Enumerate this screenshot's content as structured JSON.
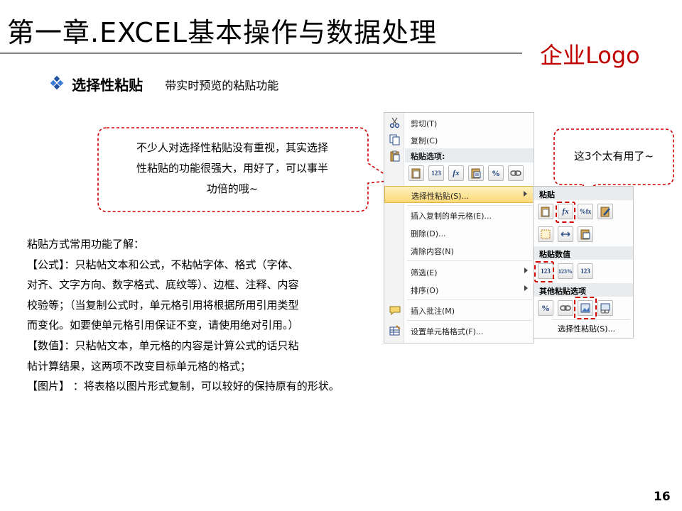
{
  "slide": {
    "title": "第一章.EXCEL基本操作与数据处理",
    "logo": "企业Logo",
    "page_number": "16"
  },
  "section": {
    "heading": "选择性粘贴",
    "description": "带实时预览的粘贴功能"
  },
  "callout_left": {
    "lines": [
      "不少人对选择性粘贴没有重视，其实选择",
      "性粘贴的功能很强大，用好了，可以事半",
      "功倍的哦~"
    ]
  },
  "callout_right": {
    "text": "这3个太有用了~"
  },
  "body": {
    "lines": [
      "粘贴方式常用功能了解：",
      "【公式】：只粘帖文本和公式，不粘帖字体、格式（字体、",
      "对齐、文字方向、数字格式、底纹等）、边框、注释、内容",
      "校验等；（当复制公式时，单元格引用将根据所用引用类型",
      "而变化。如要使单元格引用保证不变，请使用绝对引用。）",
      "【数值】：只粘帖文本，单元格的内容是计算公式的话只粘",
      "帖计算结果，这两项不改变目标单元格的格式；",
      "【图片】 ：将表格以图片形式复制，可以较好的保持原有的形状。"
    ]
  },
  "context_menu": {
    "cut": "剪切(T)",
    "copy": "复制(C)",
    "paste_options_header": "粘贴选项:",
    "paste_special": "选择性粘贴(S)...",
    "insert_copied": "插入复制的单元格(E)...",
    "delete": "删除(D)...",
    "clear": "清除内容(N)",
    "filter": "筛选(E)",
    "sort": "排序(O)",
    "insert_comment": "插入批注(M)",
    "format_cells": "设置单元格格式(F)...",
    "paste_buttons": [
      "paste-icon",
      "123",
      "fx",
      "paste-format-icon",
      "%",
      "link-icon"
    ]
  },
  "submenu": {
    "paste_header": "粘贴",
    "paste_values_header": "粘贴数值",
    "other_header": "其他粘贴选项",
    "more": "选择性粘贴(S)...",
    "values_buttons": [
      "123",
      "123%",
      "123"
    ],
    "fx_label": "fx",
    "pct_label": "%",
    "pctfx_label": "%fx"
  },
  "colors": {
    "accent_red": "#c00000",
    "dashed_red": "#d00000",
    "diamond_blue": "#1f4fa0",
    "menu_hover": "#fbd978"
  }
}
